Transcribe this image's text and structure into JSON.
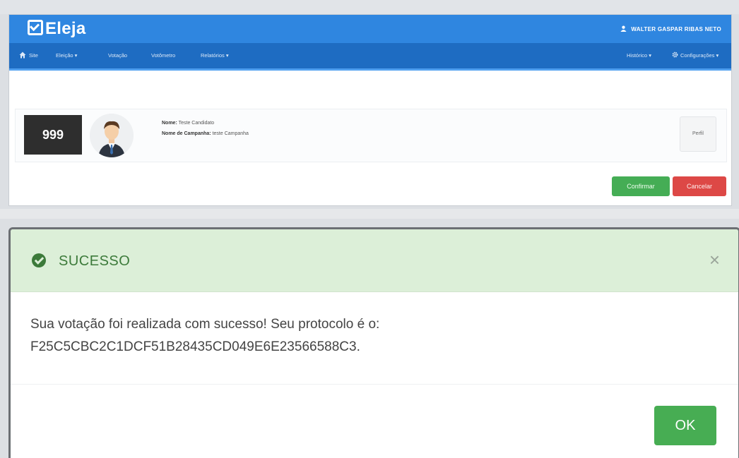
{
  "app": {
    "brand": "Eleja",
    "user_name": "WALTER GASPAR RIBAS NETO"
  },
  "nav": {
    "left_items": [
      "Site",
      "Eleição ▾",
      "Votação",
      "Votômetro",
      "Relatórios ▾"
    ],
    "right_items": [
      "Histórico ▾",
      "Configurações ▾"
    ]
  },
  "candidate": {
    "number": "999",
    "name_label": "Nome:",
    "name_value": "Teste Candidato",
    "campaign_label": "Nome de Campanha:",
    "campaign_value": "teste Campanha",
    "profile_button": "Perfil"
  },
  "actions": {
    "confirm": "Confirmar",
    "cancel": "Cancelar"
  },
  "modal": {
    "title": "SUCESSO",
    "close_symbol": "×",
    "message_line1": "Sua votação foi realizada com sucesso! Seu protocolo é o:",
    "message_line2": "F25C5CBC2C1DCF51B28435CD049E6E23566588C3.",
    "ok_label": "OK"
  },
  "colors": {
    "brand_bar": "#2f86e0",
    "nav_bar": "#1e6cc2",
    "success_header": "#dcefd8",
    "success_text": "#3c7a3a",
    "confirm_green": "#45ad55",
    "cancel_red": "#dd4846"
  }
}
